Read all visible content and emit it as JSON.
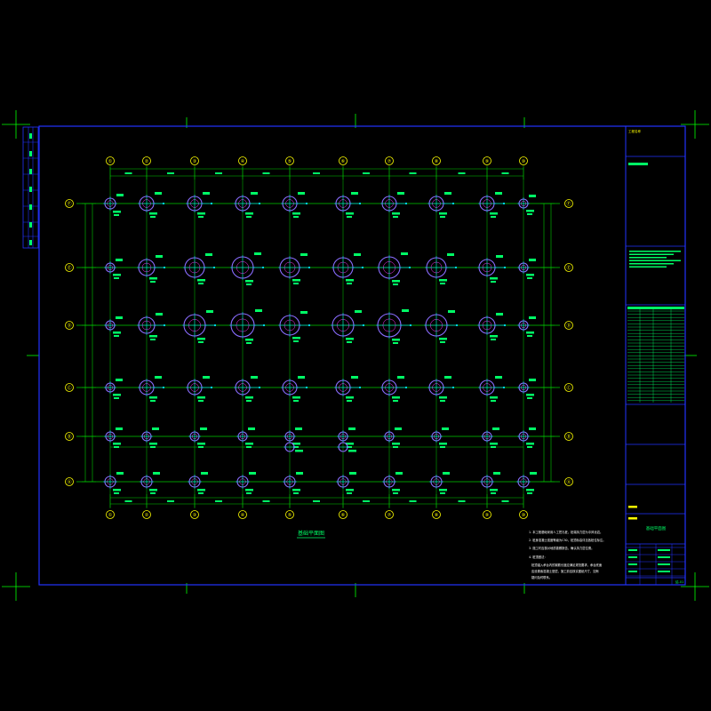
{
  "drawing": {
    "grid_columns": [
      "①",
      "②",
      "③",
      "④",
      "⑤",
      "⑥",
      "⑦",
      "⑧",
      "⑨",
      "⑩"
    ],
    "grid_rows": [
      "Ⓐ",
      "Ⓑ",
      "Ⓒ",
      "Ⓓ",
      "Ⓔ",
      "Ⓕ"
    ],
    "plan_title": "基础平面图",
    "notes_lines": [
      "1. 本工程基础采用人工挖孔桩，桩端持力层为中风化岩。",
      "2. 桩身混凝土强度等级为C30，桩顶标高详见各桩位标注。",
      "3. 施工时应核对地质勘察报告，确认持力层位置。",
      "4. 桩顶做法：",
      "桩顶锚入承台内的钢筋长度应满足规范要求，承台底面",
      "应设置素混凝土垫层，施工前应核实图纸尺寸，如有",
      "疑问及时联系。"
    ],
    "title_block": {
      "project_label": "工程名称",
      "sheet_label": "基础平面图",
      "sheet_number": "结-01"
    }
  },
  "colors": {
    "frame": "#2233ff",
    "grid": "#00cc00",
    "bubble": "#ffff00",
    "pile_outer": "#8a6cff",
    "pile_inner": "#ff33ff",
    "text": "#00ff66",
    "accent": "#00e5ff",
    "crosshair": "#00ff00"
  }
}
